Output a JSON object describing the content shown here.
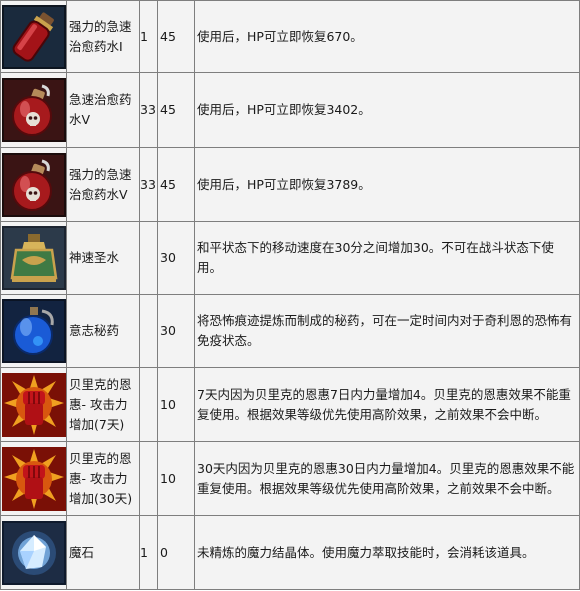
{
  "items": [
    {
      "icon": "red-potion-icon",
      "name": "强力的急速治愈药水I",
      "level": "1",
      "count": "45",
      "effect": "使用后，HP可立即恢复670。"
    },
    {
      "icon": "red-potion-skull-icon",
      "name": "急速治愈药水V",
      "level": "33",
      "count": "45",
      "effect": "使用后，HP可立即恢复3402。"
    },
    {
      "icon": "red-potion-skull-icon",
      "name": "强力的急速治愈药水V",
      "level": "33",
      "count": "45",
      "effect": "使用后，HP可立即恢复3789。"
    },
    {
      "icon": "golden-holy-water-icon",
      "name": "神速圣水",
      "level": "",
      "count": "30",
      "effect": "和平状态下的移动速度在30分之间增加30。不可在战斗状态下使用。"
    },
    {
      "icon": "blue-flask-icon",
      "name": "意志秘药",
      "level": "",
      "count": "30",
      "effect": "将恐怖痕迹提炼而制成的秘药，可在一定时间内对于奇利恩的恐怖有免疫状态。"
    },
    {
      "icon": "red-fist-icon",
      "name": "贝里克的恩惠- 攻击力增加(7天)",
      "level": "",
      "count": "10",
      "effect": "7天内因为贝里克的恩惠7日内力量增加4。贝里克的恩惠效果不能重复使用。根据效果等级优先使用高阶效果，之前效果不会中断。"
    },
    {
      "icon": "red-fist-icon",
      "name": "贝里克的恩惠- 攻击力增加(30天)",
      "level": "",
      "count": "10",
      "effect": "30天内因为贝里克的恩惠30日内力量增加4。贝里克的恩惠效果不能重复使用。根据效果等级优先使用高阶效果，之前效果不会中断。"
    },
    {
      "icon": "magic-stone-icon",
      "name": "魔石",
      "level": "1",
      "count": "0",
      "effect": "未精炼的魔力结晶体。使用魔力萃取技能时，会消耗该道具。"
    }
  ]
}
